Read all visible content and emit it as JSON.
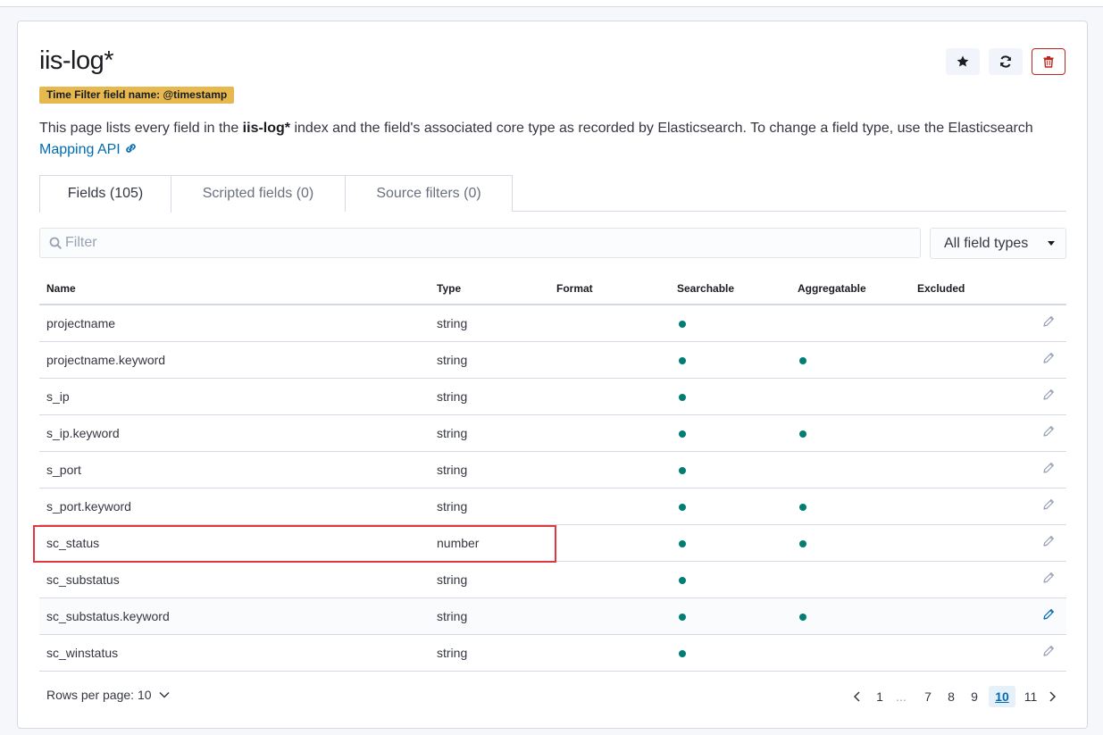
{
  "page": {
    "title": "iis-log*",
    "badge": "Time Filter field name: @timestamp",
    "desc_before": "This page lists every field in the ",
    "desc_index": "iis-log*",
    "desc_after": " index and the field's associated core type as recorded by Elasticsearch. To change a field type, use the Elasticsearch ",
    "desc_link": "Mapping API"
  },
  "header_buttons": [
    {
      "name": "star-icon"
    },
    {
      "name": "refresh-icon"
    },
    {
      "name": "trash-icon",
      "color": "#bd271e"
    }
  ],
  "tabs": [
    {
      "label": "Fields (105)",
      "active": true
    },
    {
      "label": "Scripted fields (0)",
      "active": false
    },
    {
      "label": "Source filters (0)",
      "active": false
    }
  ],
  "filter": {
    "placeholder": "Filter"
  },
  "type_select": {
    "value": "All field types"
  },
  "table": {
    "columns": [
      "Name",
      "Type",
      "Format",
      "Searchable",
      "Aggregatable",
      "Excluded"
    ],
    "rows": [
      {
        "name": "projectname",
        "type": "string",
        "format": "",
        "searchable": true,
        "aggregatable": false,
        "excluded": false
      },
      {
        "name": "projectname.keyword",
        "type": "string",
        "format": "",
        "searchable": true,
        "aggregatable": true,
        "excluded": false
      },
      {
        "name": "s_ip",
        "type": "string",
        "format": "",
        "searchable": true,
        "aggregatable": false,
        "excluded": false
      },
      {
        "name": "s_ip.keyword",
        "type": "string",
        "format": "",
        "searchable": true,
        "aggregatable": true,
        "excluded": false
      },
      {
        "name": "s_port",
        "type": "string",
        "format": "",
        "searchable": true,
        "aggregatable": false,
        "excluded": false
      },
      {
        "name": "s_port.keyword",
        "type": "string",
        "format": "",
        "searchable": true,
        "aggregatable": true,
        "excluded": false
      },
      {
        "name": "sc_status",
        "type": "number",
        "format": "",
        "searchable": true,
        "aggregatable": true,
        "excluded": false
      },
      {
        "name": "sc_substatus",
        "type": "string",
        "format": "",
        "searchable": true,
        "aggregatable": false,
        "excluded": false
      },
      {
        "name": "sc_substatus.keyword",
        "type": "string",
        "format": "",
        "searchable": true,
        "aggregatable": true,
        "excluded": false,
        "hovered": true
      },
      {
        "name": "sc_winstatus",
        "type": "string",
        "format": "",
        "searchable": true,
        "aggregatable": false,
        "excluded": false
      }
    ]
  },
  "footer": {
    "rows_per_page": "Rows per page: 10",
    "pages": [
      "1",
      "...",
      "7",
      "8",
      "9",
      "10",
      "11"
    ],
    "current_page": "10"
  },
  "colors": {
    "accent": "#006bb4",
    "dot": "#017d73",
    "badge": "#e6b84e",
    "highlight": "#e0383e"
  }
}
